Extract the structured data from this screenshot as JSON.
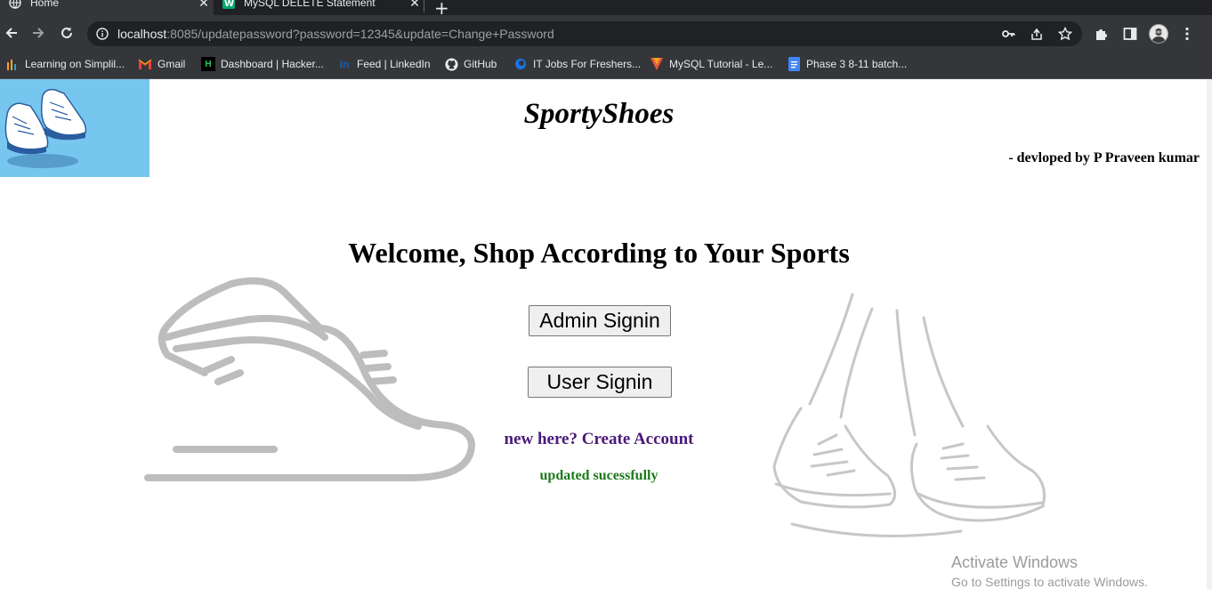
{
  "browser": {
    "tabs": [
      {
        "title": "Home",
        "active": true
      },
      {
        "title": "MySQL DELETE Statement",
        "active": false
      }
    ],
    "url_host": "localhost",
    "url_rest": ":8085/updatepassword?password=12345&update=Change+Password",
    "bookmarks": [
      {
        "label": "Learning on Simplil..."
      },
      {
        "label": "Gmail"
      },
      {
        "label": "Dashboard | Hacker..."
      },
      {
        "label": "Feed | LinkedIn"
      },
      {
        "label": "GitHub"
      },
      {
        "label": "IT Jobs For Freshers..."
      },
      {
        "label": "MySQL Tutorial - Le..."
      },
      {
        "label": "Phase 3 8-11 batch..."
      }
    ]
  },
  "page": {
    "brand": "SportyShoes",
    "developer": "- devloped by P Praveen kumar",
    "welcome": "Welcome, Shop According to Your Sports",
    "admin_button": "Admin Signin",
    "user_button": "User Signin",
    "create_link": "new here? Create Account",
    "status_message": "updated sucessfully",
    "status_color": "#1b7a1b",
    "link_color": "#4b1a7a",
    "logo_bg": "#77c6ef"
  },
  "os_watermark": {
    "line1": "Activate Windows",
    "line2": "Go to Settings to activate Windows."
  }
}
